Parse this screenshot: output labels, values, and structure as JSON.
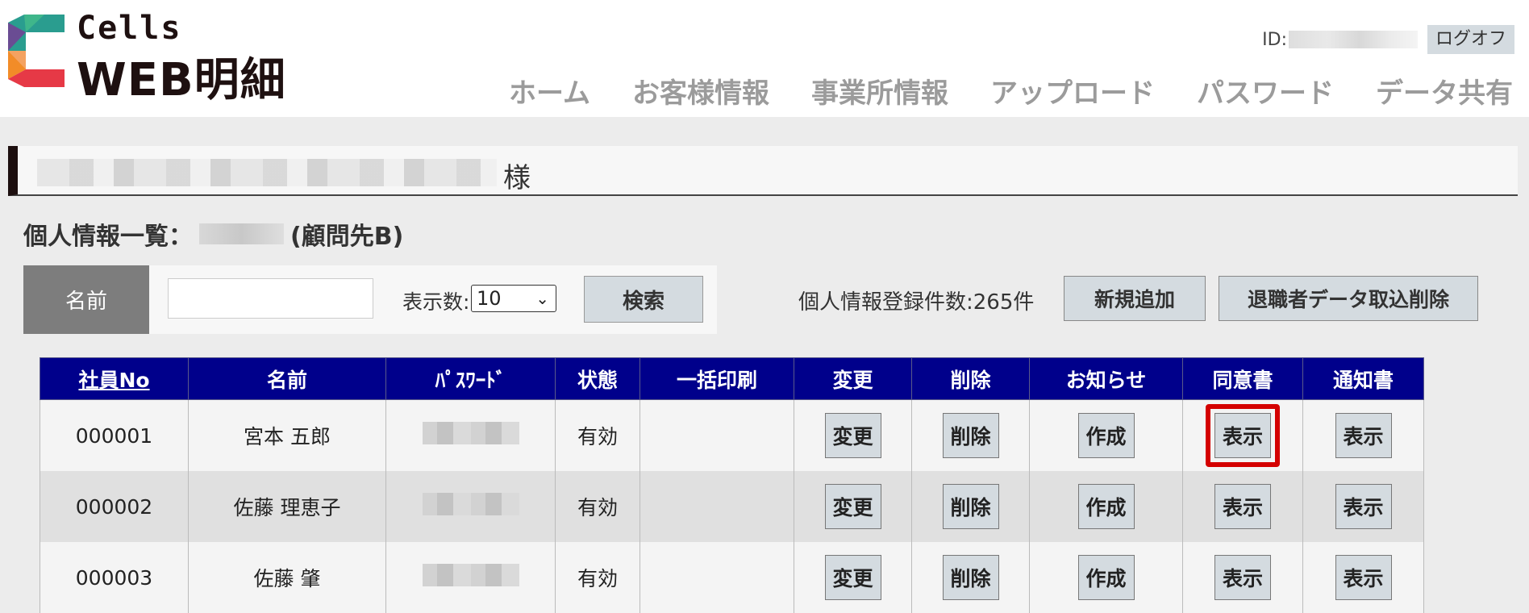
{
  "logo": {
    "top": "Cells",
    "bottom": "WEB明細"
  },
  "user": {
    "id_label": "ID:",
    "logoff": "ログオフ"
  },
  "nav": [
    "ホーム",
    "お客様情報",
    "事業所情報",
    "アップロード",
    "パスワード",
    "データ共有"
  ],
  "customer": {
    "suffix": "様"
  },
  "list": {
    "title_prefix": "個人情報一覧：",
    "title_suffix": "(顧問先B)"
  },
  "search": {
    "name_label": "名前",
    "name_value": "",
    "display_label": "表示数:",
    "display_value": "10",
    "search_button": "検索"
  },
  "registration": {
    "count_text": "個人情報登録件数:265件"
  },
  "actions": {
    "add_new": "新規追加",
    "retire_import_delete": "退職者データ取込削除"
  },
  "table": {
    "headers": [
      "社員No",
      "名前",
      "ﾊﾟｽﾜｰﾄﾞ",
      "状態",
      "一括印刷",
      "変更",
      "削除",
      "お知らせ",
      "同意書",
      "通知書"
    ],
    "rows": [
      {
        "no": "000001",
        "name": "宮本 五郎",
        "status": "有効",
        "change": "変更",
        "delete": "削除",
        "notice": "作成",
        "consent": "表示",
        "notification": "表示"
      },
      {
        "no": "000002",
        "name": "佐藤 理恵子",
        "status": "有効",
        "change": "変更",
        "delete": "削除",
        "notice": "作成",
        "consent": "表示",
        "notification": "表示"
      },
      {
        "no": "000003",
        "name": "佐藤 肇",
        "status": "有効",
        "change": "変更",
        "delete": "削除",
        "notice": "作成",
        "consent": "表示",
        "notification": "表示"
      }
    ]
  },
  "colors": {
    "table_header": "#00008b",
    "button_bg": "#d4dbe0",
    "highlight": "#d40000",
    "nav_text": "#9b9b9b"
  }
}
